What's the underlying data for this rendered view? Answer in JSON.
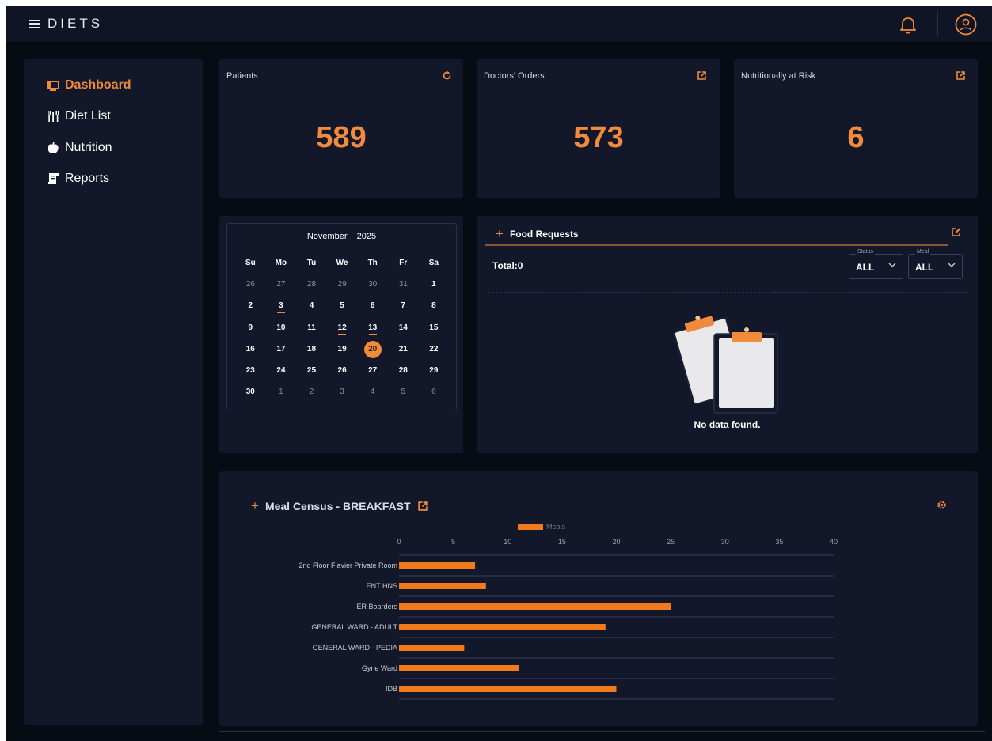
{
  "app": {
    "title": "DIETS"
  },
  "header": {
    "bell_icon": "bell-icon",
    "user_icon": "user-circle-icon"
  },
  "sidebar": {
    "items": [
      {
        "label": "Dashboard",
        "icon": "dashboard-icon",
        "active": true
      },
      {
        "label": "Diet List",
        "icon": "utensils-icon",
        "active": false
      },
      {
        "label": "Nutrition",
        "icon": "apple-icon",
        "active": false
      },
      {
        "label": "Reports",
        "icon": "scroll-icon",
        "active": false
      }
    ]
  },
  "stats": [
    {
      "title": "Patients",
      "value": "589",
      "icon": "refresh-icon"
    },
    {
      "title": "Doctors' Orders",
      "value": "573",
      "icon": "external-link-icon"
    },
    {
      "title": "Nutritionally at Risk",
      "value": "6",
      "icon": "external-link-icon"
    }
  ],
  "calendar": {
    "month": "November",
    "year": "2025",
    "weekdays": [
      "Su",
      "Mo",
      "Tu",
      "We",
      "Th",
      "Fr",
      "Sa"
    ],
    "weeks": [
      [
        "26",
        "27",
        "28",
        "29",
        "30",
        "31",
        "1"
      ],
      [
        "2",
        "3",
        "4",
        "5",
        "6",
        "7",
        "8"
      ],
      [
        "9",
        "10",
        "11",
        "12",
        "13",
        "14",
        "15"
      ],
      [
        "16",
        "17",
        "18",
        "19",
        "20",
        "21",
        "22"
      ],
      [
        "23",
        "24",
        "25",
        "26",
        "27",
        "28",
        "29"
      ],
      [
        "30",
        "1",
        "2",
        "3",
        "4",
        "5",
        "6"
      ]
    ],
    "selected_day": "20",
    "marked_days": [
      "3",
      "12",
      "13"
    ]
  },
  "food_requests": {
    "title": "Food Requests",
    "total_label": "Total:0",
    "status_filter": {
      "label": "Status",
      "value": "ALL"
    },
    "meal_filter": {
      "label": "Meal",
      "value": "ALL"
    },
    "empty_text": "No data found.",
    "accent": "#f08a3c"
  },
  "meal_census": {
    "title": "Meal Census - BREAKFAST",
    "chart_data": {
      "type": "bar",
      "orientation": "horizontal",
      "categories": [
        "2nd Floor Flavier Private Room",
        "ENT HNS",
        "ER Boarders",
        "GENERAL WARD - ADULT",
        "GENERAL WARD - PEDIA",
        "Gyne Ward",
        "IDB"
      ],
      "series": [
        {
          "name": "Meals",
          "values": [
            7,
            8,
            25,
            19,
            6,
            11,
            20
          ],
          "color": "#f07a1c"
        }
      ],
      "xlim": [
        0,
        40
      ],
      "xticks": [
        0,
        5,
        10,
        15,
        20,
        25,
        30,
        35,
        40
      ],
      "legend": "top",
      "grid": true
    }
  }
}
